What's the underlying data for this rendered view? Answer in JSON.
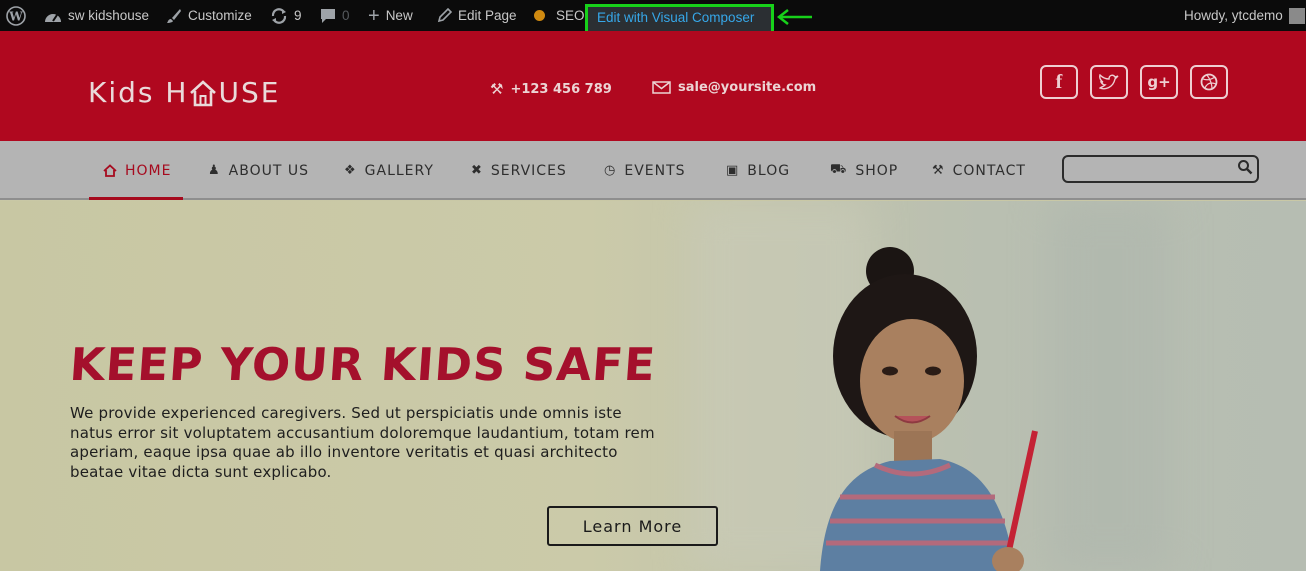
{
  "adminbar": {
    "site_name": "sw kidshouse",
    "customize": "Customize",
    "updates_count": "9",
    "comments_count": "0",
    "new": "New",
    "edit_page": "Edit Page",
    "seo": "SEO",
    "visual_composer": "Edit with Visual Composer",
    "howdy": "Howdy, ytcdemo"
  },
  "header": {
    "logo_text_left": "Kids H",
    "logo_text_right": "USE",
    "phone": "+123 456 789",
    "email": "sale@yoursite.com",
    "social": [
      "facebook",
      "twitter",
      "google-plus",
      "dribbble"
    ]
  },
  "nav": {
    "items": [
      {
        "label": "HOME",
        "icon": "house-icon"
      },
      {
        "label": "ABOUT US",
        "icon": "person-icon"
      },
      {
        "label": "GALLERY",
        "icon": "gallery-icon"
      },
      {
        "label": "SERVICES",
        "icon": "tools-icon"
      },
      {
        "label": "EVENTS",
        "icon": "clock-icon"
      },
      {
        "label": "BLOG",
        "icon": "book-icon"
      },
      {
        "label": "SHOP",
        "icon": "cart-icon"
      },
      {
        "label": "CONTACT",
        "icon": "phone-icon"
      }
    ],
    "search_placeholder": ""
  },
  "hero": {
    "title": "KEEP YOUR KIDS SAFE",
    "text_lines": [
      "We provide experienced caregivers. Sed ut perspiciatis unde omnis iste",
      "natus error sit voluptatem accusantium doloremque laudantium, totam rem",
      "aperiam, eaque ipsa quae ab illo inventore veritatis et quasi architecto",
      "beatae vitae dicta sunt explicabo."
    ],
    "button": "Learn More"
  },
  "colors": {
    "admin_bar": "#0b0b0b",
    "brand_red": "#b0081f",
    "highlight_green": "#17d11a",
    "link_blue": "#36a7e8"
  }
}
